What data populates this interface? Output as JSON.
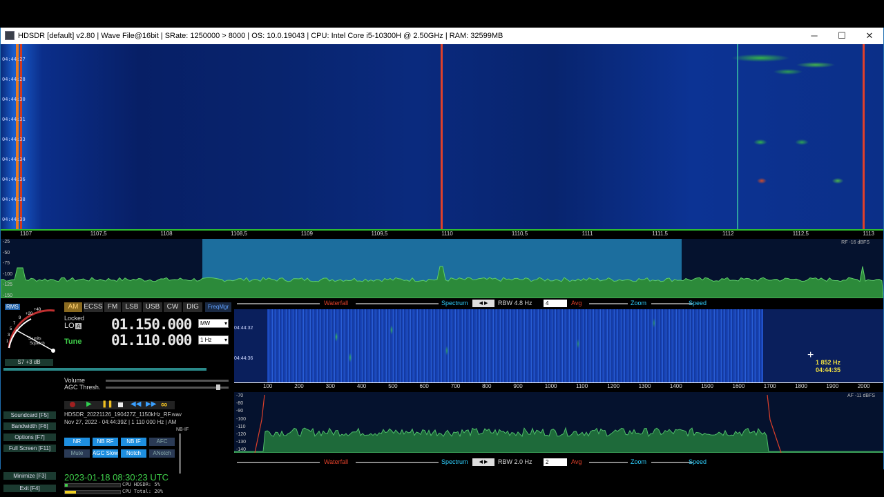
{
  "window": {
    "title": "HDSDR  [default]  v2.80   |  Wave File@16bit  |  SRate: 1250000 > 8000  |  OS: 10.0.19043  |  CPU: Intel Core i5-10300H @ 2.50GHz  |  RAM: 32599MB",
    "minimize_glyph": "─",
    "maximize_glyph": "☐",
    "close_glyph": "✕"
  },
  "main_waterfall": {
    "time_labels": [
      "04:44:27",
      "04:44:28",
      "04:44:30",
      "04:44:31",
      "04:44:33",
      "04:44:34",
      "04:44:36",
      "04:44:38",
      "04:44:39"
    ]
  },
  "rf_scale": {
    "ticks": [
      "1107",
      "1107,5",
      "1108",
      "1108,5",
      "1109",
      "1109,5",
      "1110",
      "1110,5",
      "1111",
      "1111,5",
      "1112",
      "1112,5",
      "1113"
    ]
  },
  "rf_spectrum": {
    "db_labels": [
      "-25",
      "-50",
      "-75",
      "-100",
      "-125",
      "-150"
    ],
    "level_label": "RF -16 dBFS"
  },
  "smeter": {
    "rms_label": "RMS",
    "scale_labels": [
      "+40",
      "+20",
      "9",
      "7",
      "5",
      "3",
      "1"
    ],
    "units_label": "S-units",
    "squelch_label": "Squelch",
    "reading": "S7 +3 dB"
  },
  "modes": [
    "AM",
    "ECSS",
    "FM",
    "LSB",
    "USB",
    "CW",
    "DIG",
    "FreqMgr"
  ],
  "lo": {
    "locked_label": "Locked",
    "lo_label": "LO",
    "lo_tag": "A",
    "lo_freq": "01.150.000",
    "band": "MW",
    "tune_label": "Tune",
    "tune_freq": "01.110.000",
    "step": "1 Hz"
  },
  "sliders": {
    "volume_label": "Volume",
    "agc_label": "AGC Thresh."
  },
  "menu": {
    "soundcard": "Soundcard  [F5]",
    "bandwidth": "Bandwidth  [F6]",
    "options": "Options  [F7]",
    "fullscreen": "Full Screen  [F11]",
    "minimize": "Minimize  [F3]",
    "exit": "Exit  [F4]"
  },
  "playback": {
    "file": "HDSDR_20221126_190427Z_1150kHz_RF.wav",
    "info": "Nov 27, 2022 - 04:44:39Z | 1 110 000 Hz | AM"
  },
  "dsp": {
    "nbif_label": "NB-IF",
    "buttons": [
      "NR",
      "NB RF",
      "NB IF",
      "AFC",
      "Mute",
      "AGC Slow",
      "Notch",
      "ANotch"
    ]
  },
  "status": {
    "datetime": "2023-01-18   08:30:23 UTC",
    "cpu_hdsdr": "CPU HDSDR:  5%",
    "cpu_total": "CPU Total: 20%"
  },
  "bars": {
    "waterfall": "Waterfall",
    "spectrum": "Spectrum",
    "rbw_top": "RBW  4.8 Hz",
    "avg_top": "4",
    "avg": "Avg",
    "zoom": "Zoom",
    "speed": "Speed",
    "rbw_bottom": "RBW  2.0 Hz",
    "avg_bottom": "2"
  },
  "audio_waterfall": {
    "time_labels": [
      "04:44:32",
      "04:44:36"
    ],
    "cursor_freq": "1 852 Hz",
    "cursor_time": "04:44:35"
  },
  "af_scale": {
    "ticks": [
      "100",
      "200",
      "300",
      "400",
      "500",
      "600",
      "700",
      "800",
      "900",
      "1000",
      "1100",
      "1200",
      "1300",
      "1400",
      "1500",
      "1600",
      "1700",
      "1800",
      "1900",
      "2000"
    ]
  },
  "af_spectrum": {
    "db_labels": [
      "-70",
      "-80",
      "-90",
      "-100",
      "-110",
      "-120",
      "-130",
      "-140"
    ],
    "level_label": "AF -11 dBFS"
  },
  "colors": {
    "accent_red": "#e0402a",
    "accent_cyan": "#2fd0ff",
    "accent_green": "#2fbf2f",
    "freq_display": "#e8e8e8",
    "tune_green": "#3fd04a"
  }
}
